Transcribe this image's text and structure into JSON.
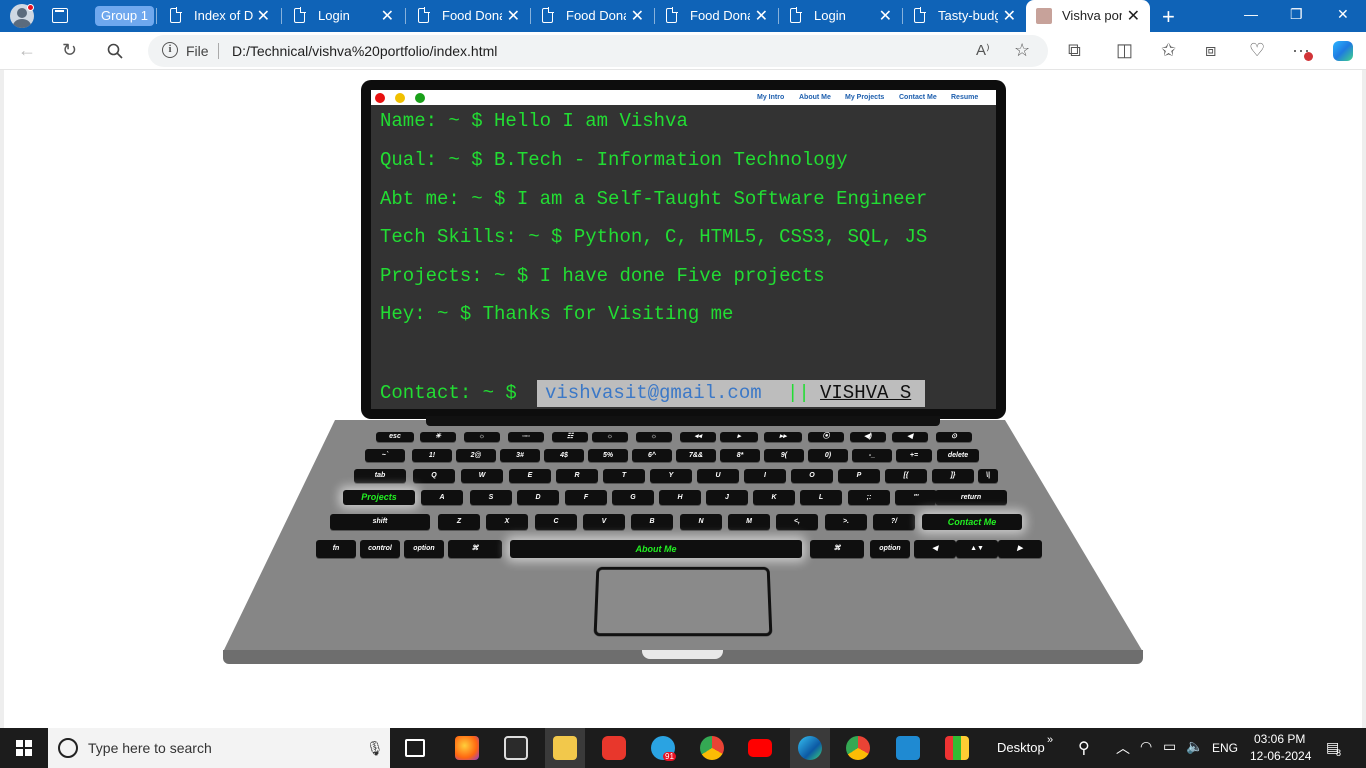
{
  "browser": {
    "group_label": "Group 1",
    "tabs": [
      {
        "title": "Index of D:",
        "close": "✕"
      },
      {
        "title": "Login",
        "close": "✕"
      },
      {
        "title": "Food Dona",
        "close": "✕"
      },
      {
        "title": "Food Dona",
        "close": "✕"
      },
      {
        "title": "Food Dona",
        "close": "✕"
      },
      {
        "title": "Login",
        "close": "✕"
      },
      {
        "title": "Tasty-budg",
        "close": "✕"
      },
      {
        "title": "Vishva port",
        "close": "✕"
      }
    ],
    "new_tab": "+",
    "window_controls": [
      "—",
      "❐",
      "✕"
    ],
    "address": {
      "scheme_label": "File",
      "url": "D:/Technical/vishva%20portfolio/index.html"
    },
    "toolbar_icons": [
      "back-icon",
      "refresh-icon",
      "search-icon",
      "read-aloud-icon",
      "favorite-star-icon",
      "extensions-icon",
      "split-screen-icon",
      "favorites-icon",
      "collections-icon",
      "browser-essentials-icon",
      "more-icon",
      "copilot-icon"
    ]
  },
  "portfolio": {
    "nav": [
      "My Intro",
      "About Me",
      "My Projects",
      "Contact Me",
      "Resume"
    ],
    "window_dots": {
      "red": "#e81010",
      "yellow": "#f0c000",
      "green": "#1aa01a"
    },
    "lines": [
      "Name: ~ $ Hello I am Vishva",
      "Qual: ~ $ B.Tech - Information Technology",
      "Abt me: ~ $ I am a Self-Taught Software Engineer",
      "Tech Skills: ~ $ Python, C, HTML5, CSS3, SQL, JS",
      "Projects: ~ $ I have done Five projects",
      "Hey: ~ $ Thanks for Visiting me"
    ],
    "contact_prefix": "Contact: ~ $",
    "contact_email": "vishvasit@gmail.com",
    "contact_sep": "||",
    "contact_name": "VISHVA S",
    "term_color": "#22dd33"
  },
  "keyboard": {
    "row1": [
      "esc",
      "☀",
      "☼",
      "▫▫▫",
      "☷",
      "☼",
      "☼",
      "◂◂",
      "▸",
      "▸▸",
      "⦿",
      "◀)",
      "◀",
      "⊙"
    ],
    "row2": [
      "~`",
      "1!",
      "2@",
      "3#",
      "4$",
      "5%",
      "6^",
      "7&&",
      "8*",
      "9(",
      "0)",
      "-_",
      "+=",
      "delete"
    ],
    "row3": [
      "tab",
      "Q",
      "W",
      "E",
      "R",
      "T",
      "Y",
      "U",
      "I",
      "O",
      "P",
      "[{",
      "]}",
      "\\|"
    ],
    "row4": [
      "Projects",
      "A",
      "S",
      "D",
      "F",
      "G",
      "H",
      "J",
      "K",
      "L",
      ";:",
      "\"'",
      "return"
    ],
    "row5": [
      "shift",
      "Z",
      "X",
      "C",
      "V",
      "B",
      "N",
      "M",
      "<,",
      ">.",
      "?/",
      "Contact Me"
    ],
    "row6": [
      "fn",
      "control",
      "option",
      "⌘",
      "About Me",
      "⌘",
      "option",
      "◀",
      "▲▼",
      "▶"
    ]
  },
  "taskbar": {
    "search_placeholder": "Type here to search",
    "desktop_label": "Desktop",
    "language": "ENG",
    "time": "03:06 PM",
    "date": "12-06-2024",
    "notification_count": "8",
    "telegram_badge": "91"
  }
}
